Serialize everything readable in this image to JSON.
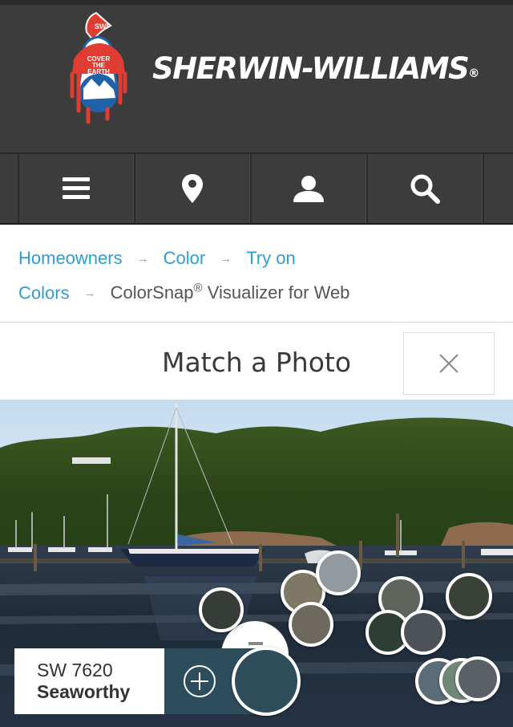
{
  "header": {
    "brand": "SHERWIN-WILLIAMS",
    "registered_mark": "®",
    "logo_text": [
      "COVER",
      "THE",
      "EARTH"
    ],
    "logo_tag": "SWP"
  },
  "nav": {
    "items": [
      {
        "name": "menu",
        "icon": "hamburger-menu-icon"
      },
      {
        "name": "store-locator",
        "icon": "map-pin-icon"
      },
      {
        "name": "account",
        "icon": "user-icon"
      },
      {
        "name": "search",
        "icon": "search-icon"
      }
    ]
  },
  "breadcrumb": {
    "items": [
      "Homeowners",
      "Color",
      "Try on",
      "Colors"
    ],
    "current": "ColorSnap",
    "current_mark": "®",
    "current_suffix": " Visualizer for Web",
    "separator": "→"
  },
  "page": {
    "title": "Match a Photo",
    "close_icon": "close-icon"
  },
  "swatches": [
    {
      "name": "swatch-1",
      "color": "#363c37"
    },
    {
      "name": "swatch-2",
      "color": "#807867"
    },
    {
      "name": "swatch-3",
      "color": "#939a9f"
    },
    {
      "name": "swatch-4",
      "color": "#6d695e"
    },
    {
      "name": "swatch-5",
      "color": "#5f655d"
    },
    {
      "name": "swatch-6",
      "color": "#3a4238"
    },
    {
      "name": "swatch-7",
      "color": "#2e3e34"
    },
    {
      "name": "swatch-8",
      "color": "#4c5257"
    },
    {
      "name": "swatch-9",
      "color": "#5a6d78"
    },
    {
      "name": "swatch-10",
      "color": "#708878"
    },
    {
      "name": "swatch-11",
      "color": "#5b6066"
    }
  ],
  "selected_color": {
    "code": "SW 7620",
    "name": "Seaworthy",
    "hex": "#2f4d5a",
    "add_icon": "plus-circle-icon"
  },
  "colors": {
    "header_bg": "#3c3c3c",
    "link": "#2f9ecf",
    "logo_red": "#e03c31",
    "logo_blue": "#1f62a8"
  }
}
